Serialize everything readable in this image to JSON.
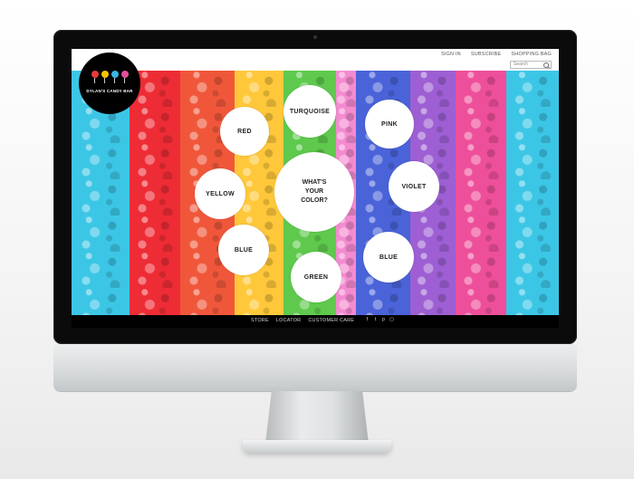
{
  "header": {
    "nav": [
      "SIGN IN",
      "SUBSCRIBE",
      "SHOPPING BAG"
    ],
    "search_placeholder": "Search"
  },
  "logo": {
    "text": "DYLAN'S CANDY BAR"
  },
  "hero": {
    "center_label": "WHAT'S\nYOUR\nCOLOR?",
    "bubbles": [
      "RED",
      "TURQUOISE",
      "PINK",
      "YELLOW",
      "VIOLET",
      "BLUE",
      "GREEN",
      "BLUE"
    ]
  },
  "footer": {
    "nav": [
      "STORE",
      "LOCATOR",
      "CUSTOMER CARE"
    ],
    "social": [
      "facebook-icon",
      "twitter-icon",
      "pinterest-icon",
      "instagram-icon"
    ]
  },
  "colors": {
    "stripes": [
      "#3cc6e6",
      "#ee2c35",
      "#f0573a",
      "#ffc83a",
      "#5ec94d",
      "#f48ad0",
      "#4a63d8",
      "#9d5fd3",
      "#ee4f9a",
      "#3cc6e6"
    ]
  }
}
